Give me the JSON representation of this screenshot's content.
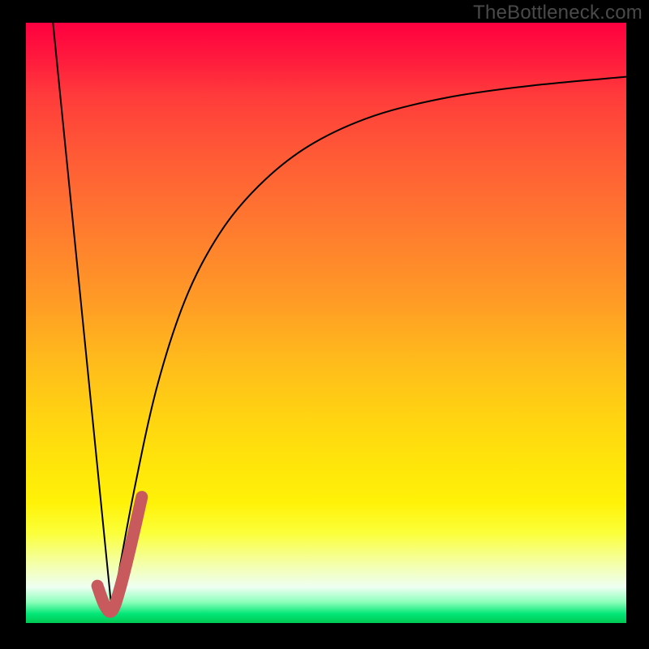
{
  "watermark": {
    "text": "TheBottleneck.com"
  },
  "colors": {
    "gradient_top": "#ff0040",
    "gradient_mid1": "#ff9a26",
    "gradient_mid2": "#ffe60a",
    "gradient_pale": "#eefff2",
    "gradient_bottom": "#00c853",
    "curve_thin": "#000000",
    "curve_highlight": "#c85a5e",
    "frame": "#000000"
  },
  "chart_data": {
    "type": "line",
    "title": "",
    "xlabel": "",
    "ylabel": "",
    "xlim": [
      0,
      100
    ],
    "ylim": [
      0,
      100
    ],
    "grid": false,
    "legend": false,
    "annotations": [
      "TheBottleneck.com"
    ],
    "series": [
      {
        "name": "left-branch",
        "x": [
          4.5,
          14.3
        ],
        "y": [
          100,
          2
        ]
      },
      {
        "name": "right-branch",
        "x": [
          14.3,
          18,
          22,
          27,
          33,
          40,
          48,
          58,
          70,
          84,
          100
        ],
        "y": [
          2,
          22,
          40,
          55,
          66,
          74,
          80,
          84.5,
          87.5,
          89.5,
          91
        ]
      },
      {
        "name": "highlight-j",
        "x": [
          11.9,
          13.1,
          14.3,
          15.6,
          17.6,
          19.3
        ],
        "y": [
          6.2,
          3.0,
          2.0,
          5.5,
          13.5,
          21.0
        ]
      }
    ]
  }
}
